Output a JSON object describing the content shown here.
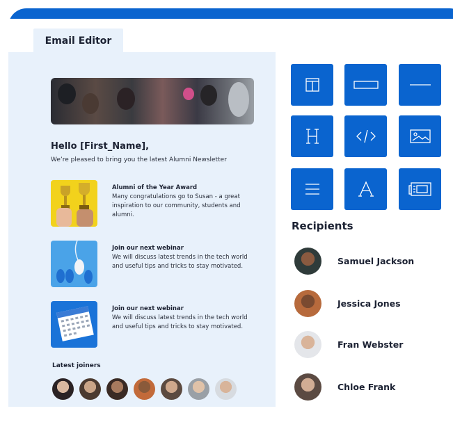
{
  "editor": {
    "tab_label": "Email Editor",
    "greeting": "Hello [First_Name],",
    "intro": "We’re pleased to bring you the latest Alumni Newsletter",
    "articles": [
      {
        "title": "Alumni of the Year Award",
        "body": "Many congratulations go to Susan - a great inspiration to our community, students and alumni.",
        "image": "trophies-image"
      },
      {
        "title": "Join our next webinar",
        "body": "We will discuss latest trends in the tech world and useful tips and tricks to stay motivated.",
        "image": "mouse-image"
      },
      {
        "title": "Join our next webinar",
        "body": "We will discuss latest trends in the tech world and useful tips and tricks to stay motivated.",
        "image": "calendar-image"
      }
    ],
    "latest_joiners_label": "Latest joiners",
    "joiner_count": 7
  },
  "blocks": [
    {
      "icon": "columns-icon"
    },
    {
      "icon": "button-icon"
    },
    {
      "icon": "divider-icon"
    },
    {
      "icon": "heading-icon"
    },
    {
      "icon": "code-icon"
    },
    {
      "icon": "image-icon"
    },
    {
      "icon": "text-icon"
    },
    {
      "icon": "font-icon"
    },
    {
      "icon": "video-icon"
    }
  ],
  "recipients": {
    "title": "Recipients",
    "people": [
      {
        "name": "Samuel Jackson"
      },
      {
        "name": "Jessica Jones"
      },
      {
        "name": "Fran Webster"
      },
      {
        "name": "Chloe Frank"
      }
    ]
  },
  "colors": {
    "accent": "#0a64cf",
    "canvas": "#e8f1fb",
    "text": "#1c2233"
  }
}
